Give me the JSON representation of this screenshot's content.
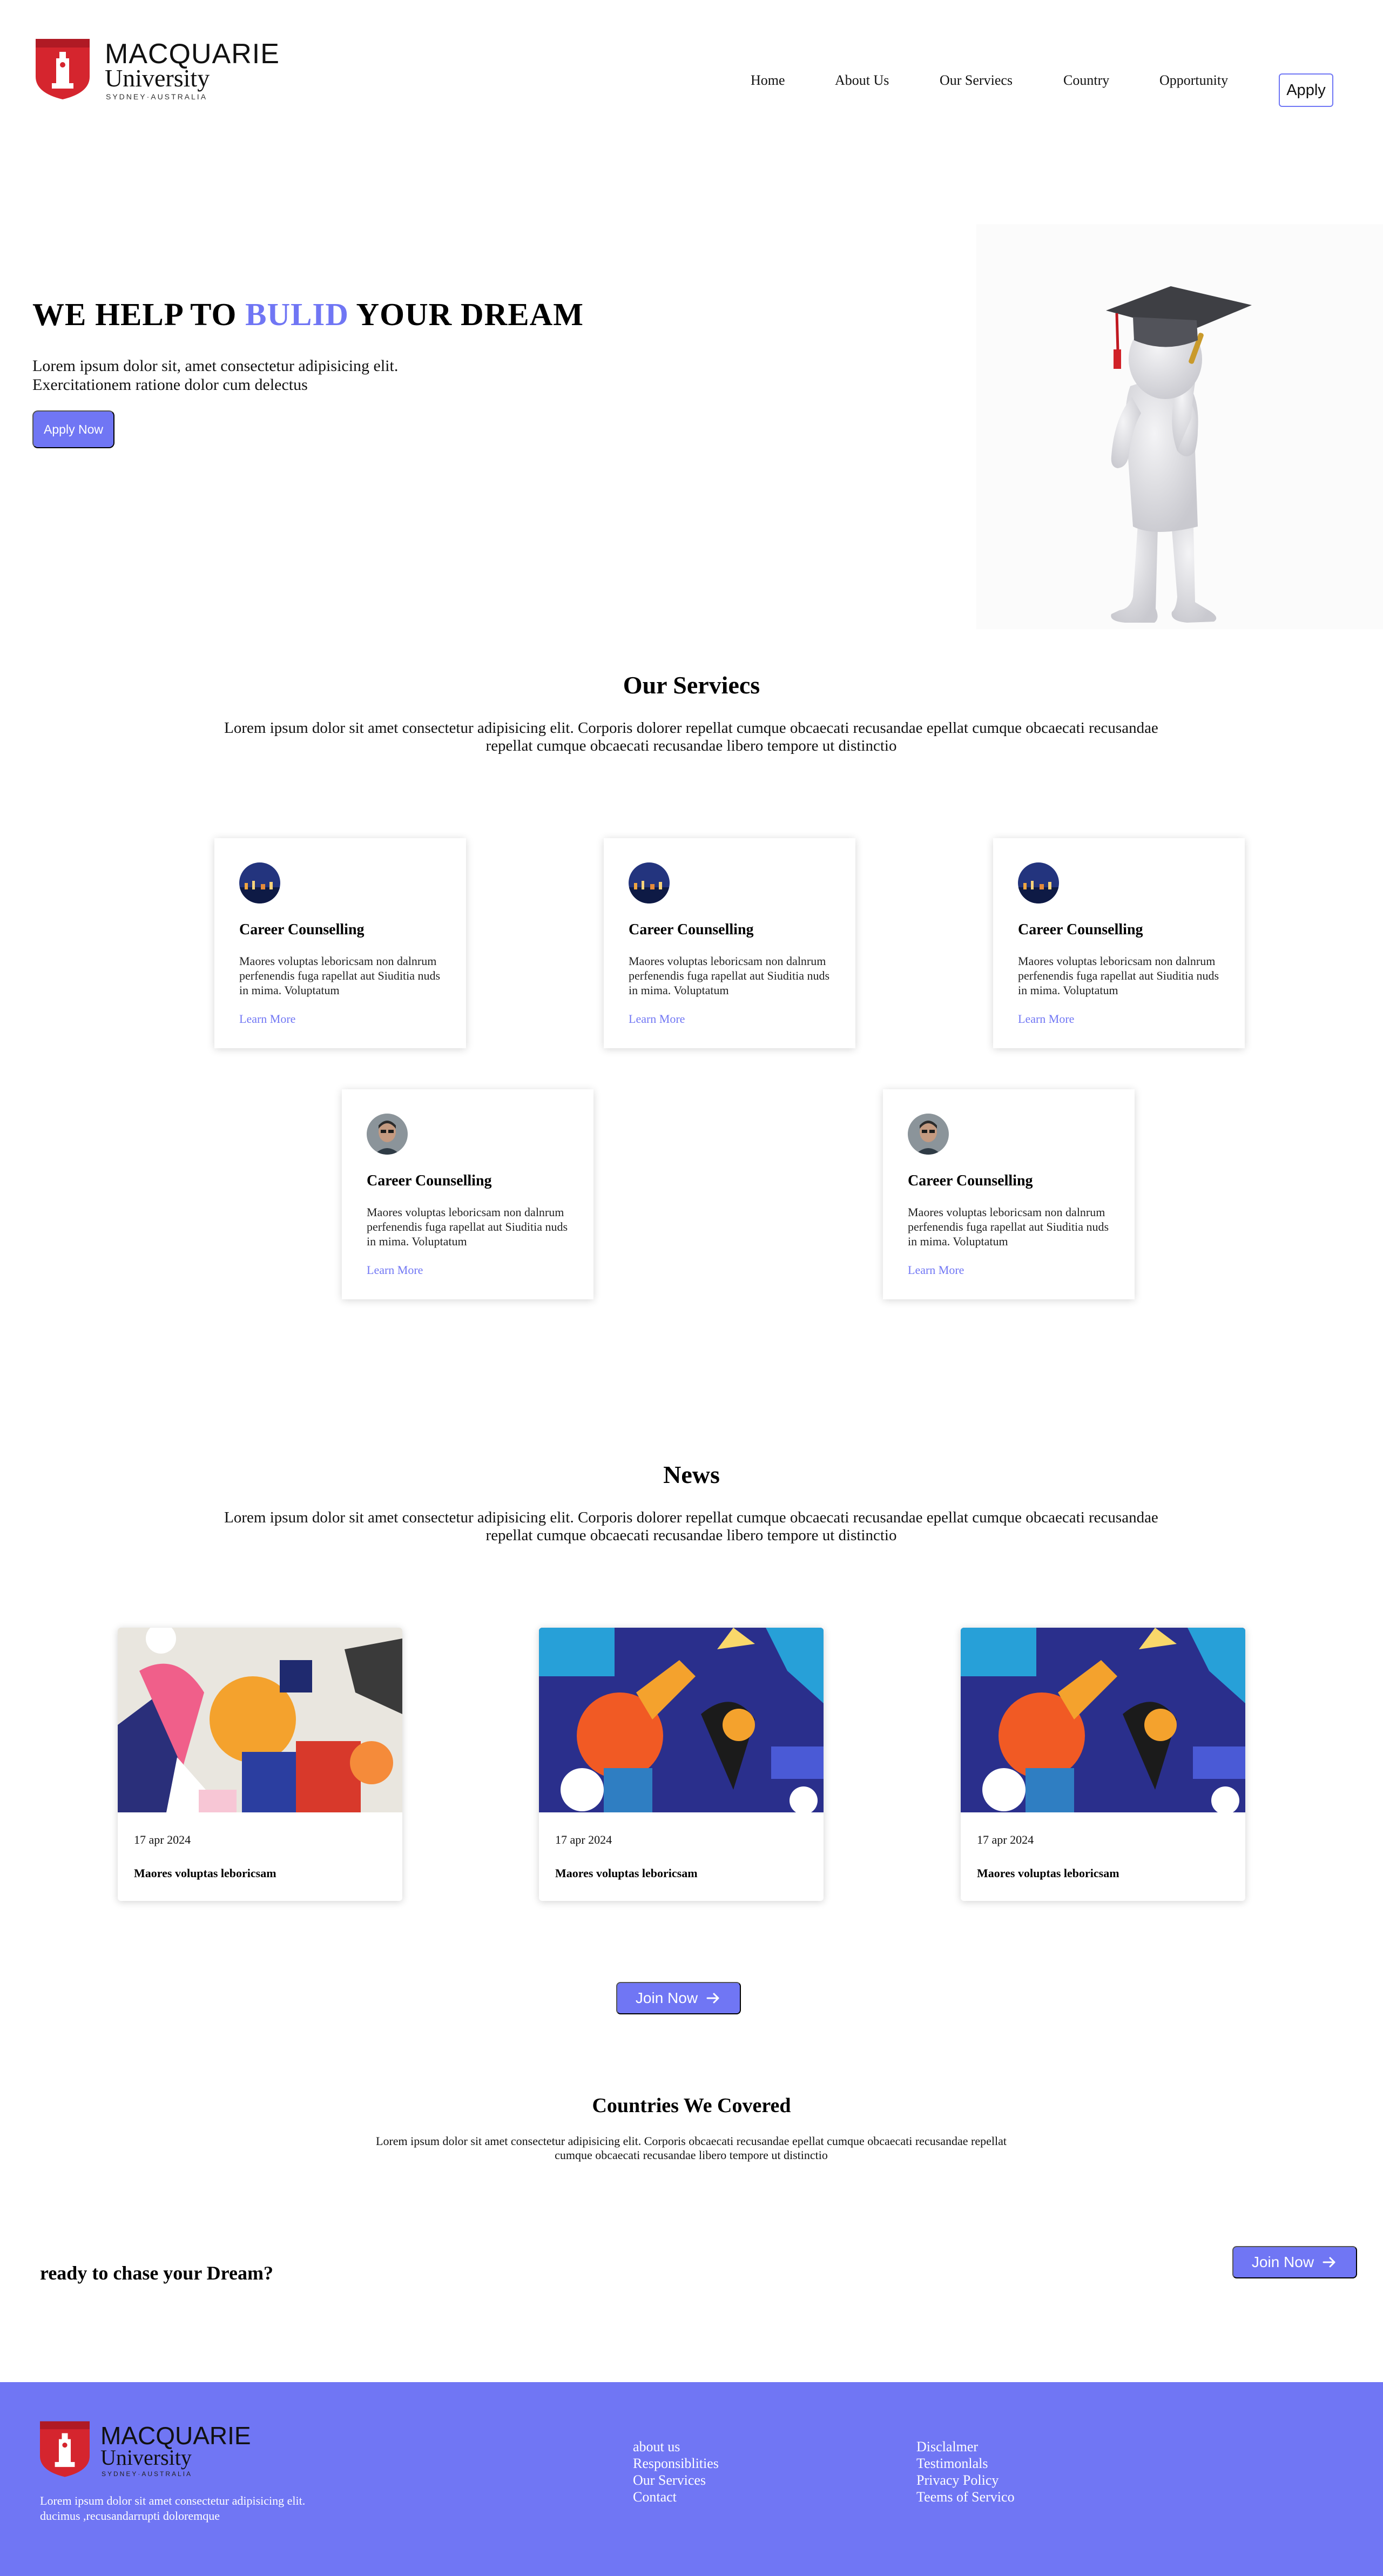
{
  "brand": {
    "name_line1": "MACQUARIE",
    "name_line2": "University",
    "tagline": "SYDNEY·AUSTRALIA",
    "accent_color": "#7076f4",
    "shield_color": "#d5252e"
  },
  "nav": {
    "items": [
      "Home",
      "About Us",
      "Our Serviecs",
      "Country",
      "Opportunity"
    ],
    "apply_label": "Apply"
  },
  "hero": {
    "title_pre": "WE HELP TO ",
    "title_accent": "BULID",
    "title_post": " YOUR DREAM",
    "text_line1": "Lorem ipsum dolor sit, amet consectetur adipisicing elit.",
    "text_line2": "Exercitationem ratione dolor cum delectus",
    "button_label": "Apply Now",
    "image_icon": "graduate-figure-icon"
  },
  "services": {
    "title": "Our Serviecs",
    "text": "Lorem ipsum dolor sit amet consectetur adipisicing elit. Corporis dolorer repellat cumque obcaecati recusandae epellat cumque obcaecati recusandae repellat cumque obcaecati recusandae libero tempore ut distinctio",
    "cards": [
      {
        "title": "Career Counselling",
        "text": "Maores voluptas leboricsam non dalnrum perfenendis fuga rapellat aut Siuditia nuds in mima. Voluptatum",
        "link": "Learn More",
        "avatar": "city-night-avatar"
      },
      {
        "title": "Career Counselling",
        "text": "Maores voluptas leboricsam non dalnrum perfenendis fuga rapellat aut Siuditia nuds in mima. Voluptatum",
        "link": "Learn More",
        "avatar": "city-night-avatar"
      },
      {
        "title": "Career Counselling",
        "text": "Maores voluptas leboricsam non dalnrum perfenendis fuga rapellat aut Siuditia nuds in mima. Voluptatum",
        "link": "Learn More",
        "avatar": "city-night-avatar"
      },
      {
        "title": "Career Counselling",
        "text": "Maores voluptas leboricsam non dalnrum perfenendis fuga rapellat aut Siuditia nuds in mima. Voluptatum",
        "link": "Learn More",
        "avatar": "person-avatar"
      },
      {
        "title": "Career Counselling",
        "text": "Maores voluptas leboricsam non dalnrum perfenendis fuga rapellat aut Siuditia nuds in mima. Voluptatum",
        "link": "Learn More",
        "avatar": "person-avatar"
      }
    ]
  },
  "news": {
    "title": "News",
    "text": "Lorem ipsum dolor sit amet consectetur adipisicing elit. Corporis dolorer repellat cumque obcaecati recusandae epellat cumque obcaecati recusandae repellat cumque obcaecati recusandae libero tempore ut distinctio",
    "cards": [
      {
        "date": "17 apr 2024",
        "title": "Maores voluptas leboricsam",
        "image": "abstract-illustration-warm"
      },
      {
        "date": "17 apr 2024",
        "title": "Maores voluptas leboricsam",
        "image": "abstract-illustration-blue"
      },
      {
        "date": "17 apr 2024",
        "title": "Maores voluptas leboricsam",
        "image": "abstract-illustration-blue"
      }
    ],
    "join_label": "Join Now"
  },
  "countries": {
    "title": "Countries We Covered",
    "text": "Lorem ipsum dolor sit amet consectetur adipisicing elit. Corporis obcaecati recusandae epellat cumque obcaecati recusandae repellat cumque obcaecati recusandae libero tempore ut distinctio"
  },
  "cta": {
    "text": "ready to chase your Dream?",
    "button_label": "Join Now"
  },
  "footer": {
    "text_line1": "Lorem ipsum dolor sit amet consectetur adipisicing elit.",
    "text_line2": "ducimus ,recusandarrupti doloremque",
    "col1": [
      "about us",
      "Responsiblities",
      "Our Services",
      "Contact"
    ],
    "col2": [
      "Disclalmer",
      "Testimonlals",
      "Privacy Policy",
      "Teems of Servico"
    ]
  }
}
